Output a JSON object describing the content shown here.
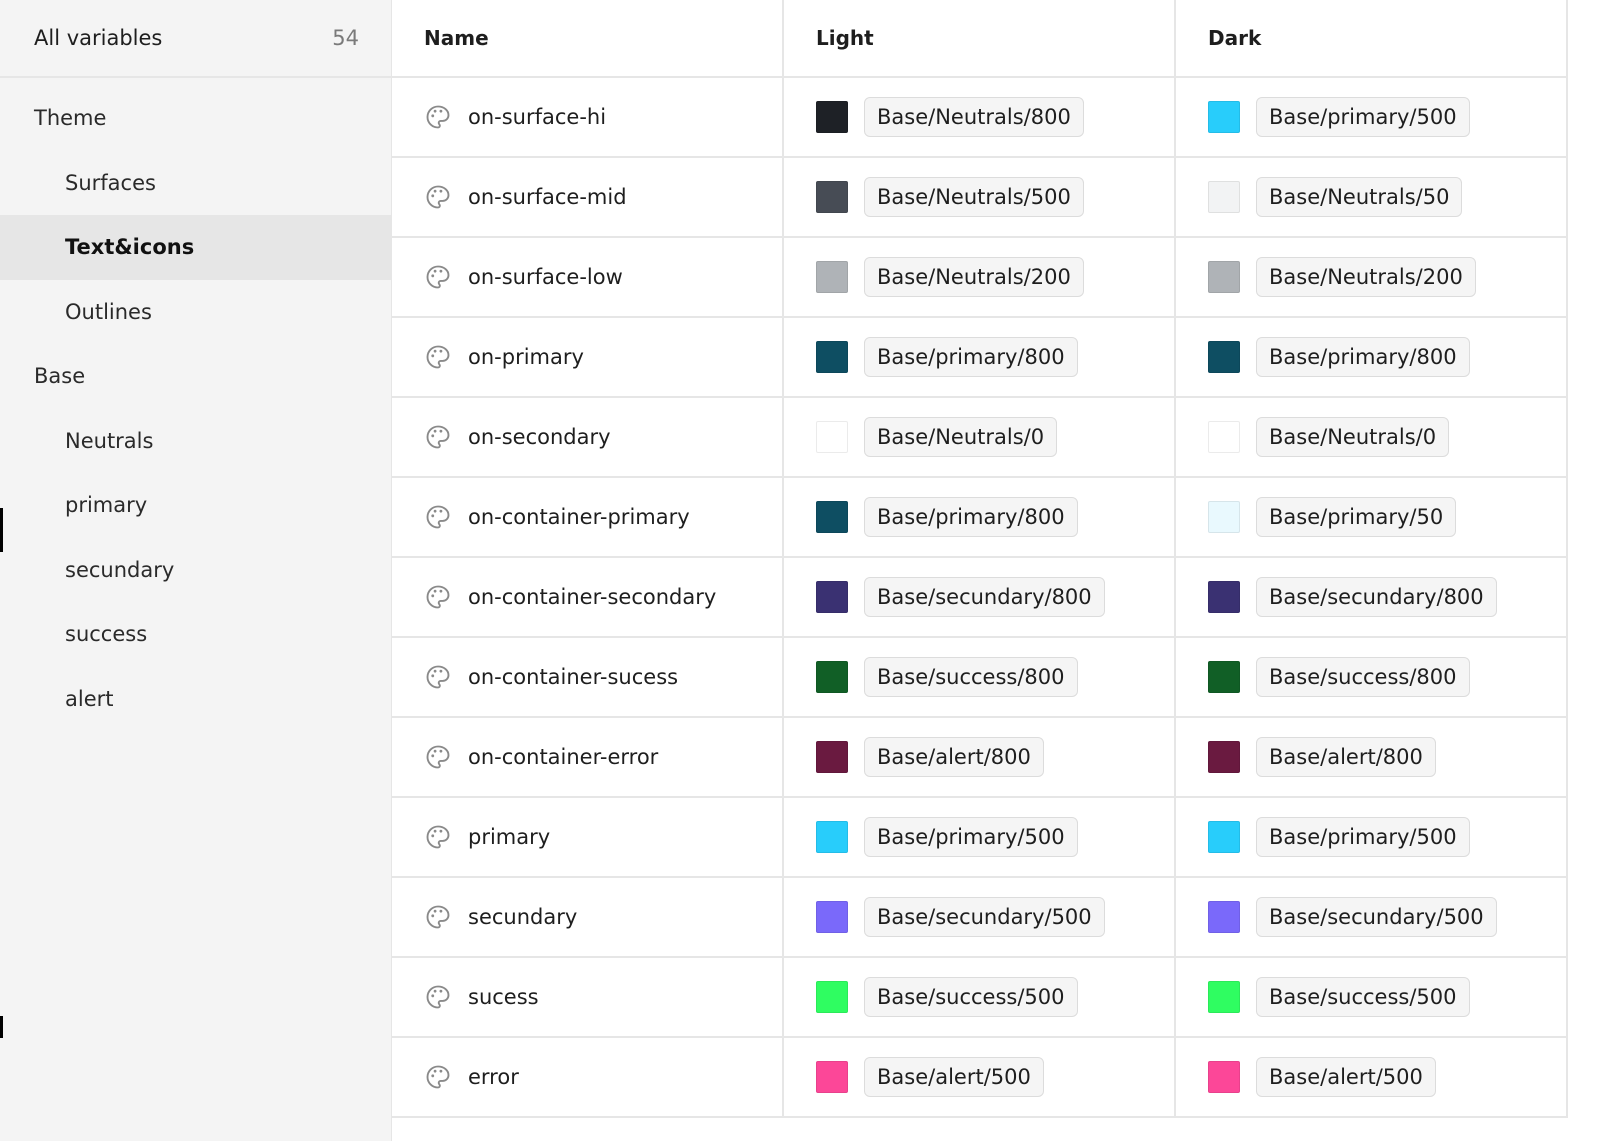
{
  "sidebar": {
    "header_label": "All variables",
    "header_count": "54",
    "items": [
      {
        "label": "Theme",
        "level": "group",
        "active": false
      },
      {
        "label": "Surfaces",
        "level": "sub",
        "active": false
      },
      {
        "label": "Text&icons",
        "level": "sub",
        "active": true
      },
      {
        "label": "Outlines",
        "level": "sub",
        "active": false
      },
      {
        "label": "Base",
        "level": "group",
        "active": false
      },
      {
        "label": "Neutrals",
        "level": "sub",
        "active": false
      },
      {
        "label": "primary",
        "level": "sub",
        "active": false
      },
      {
        "label": "secundary",
        "level": "sub",
        "active": false
      },
      {
        "label": "success",
        "level": "sub",
        "active": false
      },
      {
        "label": "alert",
        "level": "sub",
        "active": false
      }
    ]
  },
  "table": {
    "columns": [
      "Name",
      "Light",
      "Dark"
    ],
    "rows": [
      {
        "name": "on-surface-hi",
        "light": {
          "color": "#1e2126",
          "token": "Base/Neutrals/800"
        },
        "dark": {
          "color": "#28cdfb",
          "token": "Base/primary/500"
        }
      },
      {
        "name": "on-surface-mid",
        "light": {
          "color": "#474c55",
          "token": "Base/Neutrals/500"
        },
        "dark": {
          "color": "#f2f3f4",
          "token": "Base/Neutrals/50"
        }
      },
      {
        "name": "on-surface-low",
        "light": {
          "color": "#afb3b7",
          "token": "Base/Neutrals/200"
        },
        "dark": {
          "color": "#afb3b7",
          "token": "Base/Neutrals/200"
        }
      },
      {
        "name": "on-primary",
        "light": {
          "color": "#0e4e62",
          "token": "Base/primary/800"
        },
        "dark": {
          "color": "#0e4e62",
          "token": "Base/primary/800"
        }
      },
      {
        "name": "on-secondary",
        "light": {
          "color": "#ffffff",
          "token": "Base/Neutrals/0"
        },
        "dark": {
          "color": "#ffffff",
          "token": "Base/Neutrals/0"
        }
      },
      {
        "name": "on-container-primary",
        "light": {
          "color": "#0e4e62",
          "token": "Base/primary/800"
        },
        "dark": {
          "color": "#e9f9fe",
          "token": "Base/primary/50"
        }
      },
      {
        "name": "on-container-secondary",
        "light": {
          "color": "#3a3172",
          "token": "Base/secundary/800"
        },
        "dark": {
          "color": "#3a3172",
          "token": "Base/secundary/800"
        }
      },
      {
        "name": "on-container-sucess",
        "light": {
          "color": "#115f26",
          "token": "Base/success/800"
        },
        "dark": {
          "color": "#115f26",
          "token": "Base/success/800"
        }
      },
      {
        "name": "on-container-error",
        "light": {
          "color": "#6a1a40",
          "token": "Base/alert/800"
        },
        "dark": {
          "color": "#6a1a40",
          "token": "Base/alert/800"
        }
      },
      {
        "name": "primary",
        "light": {
          "color": "#28cdfb",
          "token": "Base/primary/500"
        },
        "dark": {
          "color": "#28cdfb",
          "token": "Base/primary/500"
        }
      },
      {
        "name": "secundary",
        "light": {
          "color": "#7a69fa",
          "token": "Base/secundary/500"
        },
        "dark": {
          "color": "#7a69fa",
          "token": "Base/secundary/500"
        }
      },
      {
        "name": "sucess",
        "light": {
          "color": "#2ffd61",
          "token": "Base/success/500"
        },
        "dark": {
          "color": "#2ffd61",
          "token": "Base/success/500"
        }
      },
      {
        "name": "error",
        "light": {
          "color": "#fc4798",
          "token": "Base/alert/500"
        },
        "dark": {
          "color": "#fc4798",
          "token": "Base/alert/500"
        }
      }
    ]
  },
  "icons": {
    "row_icon": "palette-icon"
  }
}
